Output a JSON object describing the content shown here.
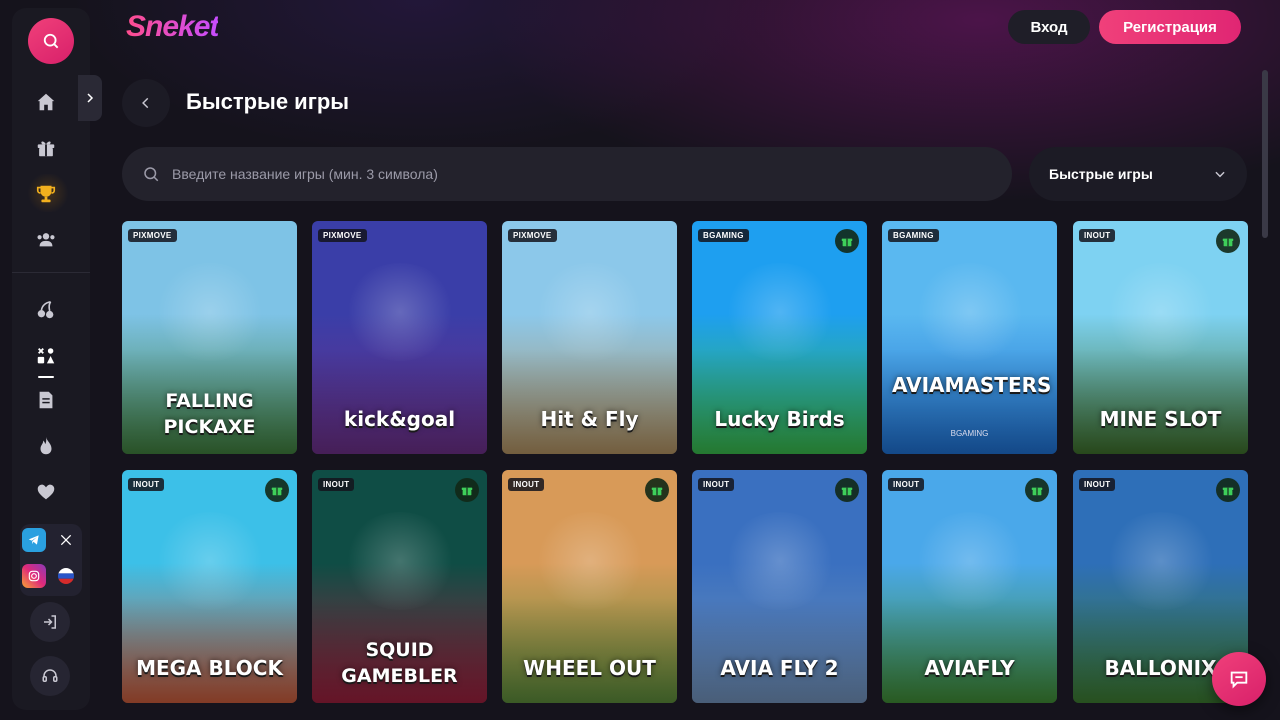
{
  "brand": {
    "logo": "Sneket",
    "accent": "#e8306f"
  },
  "header": {
    "login_label": "Вход",
    "register_label": "Регистрация"
  },
  "page": {
    "title": "Быстрые игры"
  },
  "search": {
    "placeholder": "Введите название игры (мин. 3 символа)"
  },
  "category_filter": {
    "selected": "Быстрые игры"
  },
  "sidebar": {
    "items": [
      "home-icon",
      "gift-icon",
      "trophy-icon",
      "users-icon",
      "cherries-icon",
      "games-icon",
      "document-icon",
      "fire-icon",
      "heart-icon"
    ],
    "social": [
      "telegram-icon",
      "x-icon",
      "instagram-icon",
      "language-flag-ru-icon"
    ]
  },
  "games": [
    {
      "provider": "PIXMOVE",
      "name": "FALLING PICKAXE",
      "gift": false,
      "colors": [
        "#7ec3e6",
        "#3f7d3c"
      ]
    },
    {
      "provider": "PIXMOVE",
      "name": "kick&goal",
      "gift": false,
      "colors": [
        "#3a3ea8",
        "#6b2f86"
      ]
    },
    {
      "provider": "PIXMOVE",
      "name": "Hit & Fly",
      "gift": false,
      "colors": [
        "#8cc8ea",
        "#b09060"
      ]
    },
    {
      "provider": "BGAMING",
      "name": "Lucky Birds",
      "gift": true,
      "colors": [
        "#1e9ff0",
        "#38b84a"
      ]
    },
    {
      "provider": "BGAMING",
      "name": "AVIAMASTERS",
      "sub": "BGAMING",
      "gift": false,
      "colors": [
        "#5ab8f0",
        "#1e6fd0"
      ]
    },
    {
      "provider": "INOUT",
      "name": "MINE SLOT",
      "gift": true,
      "colors": [
        "#7ed2f2",
        "#3d6e2a"
      ]
    },
    {
      "provider": "INOUT",
      "name": "MEGA BLOCK",
      "gift": true,
      "colors": [
        "#3cc0e8",
        "#c85a3a"
      ]
    },
    {
      "provider": "INOUT",
      "name": "SQUID GAMEBLER",
      "gift": true,
      "colors": [
        "#0f4d45",
        "#9a1f3c"
      ]
    },
    {
      "provider": "INOUT",
      "name": "WHEEL OUT",
      "gift": true,
      "colors": [
        "#d89a58",
        "#5a8a3a"
      ]
    },
    {
      "provider": "INOUT",
      "name": "AVIA FLY 2",
      "gift": true,
      "colors": [
        "#3a70c0",
        "#7090b8"
      ]
    },
    {
      "provider": "INOUT",
      "name": "AVIAFLY",
      "gift": true,
      "colors": [
        "#4aa8ea",
        "#3f8a34"
      ]
    },
    {
      "provider": "INOUT",
      "name": "BALLONIX",
      "gift": true,
      "colors": [
        "#2e6fb8",
        "#3c7a30"
      ]
    }
  ]
}
